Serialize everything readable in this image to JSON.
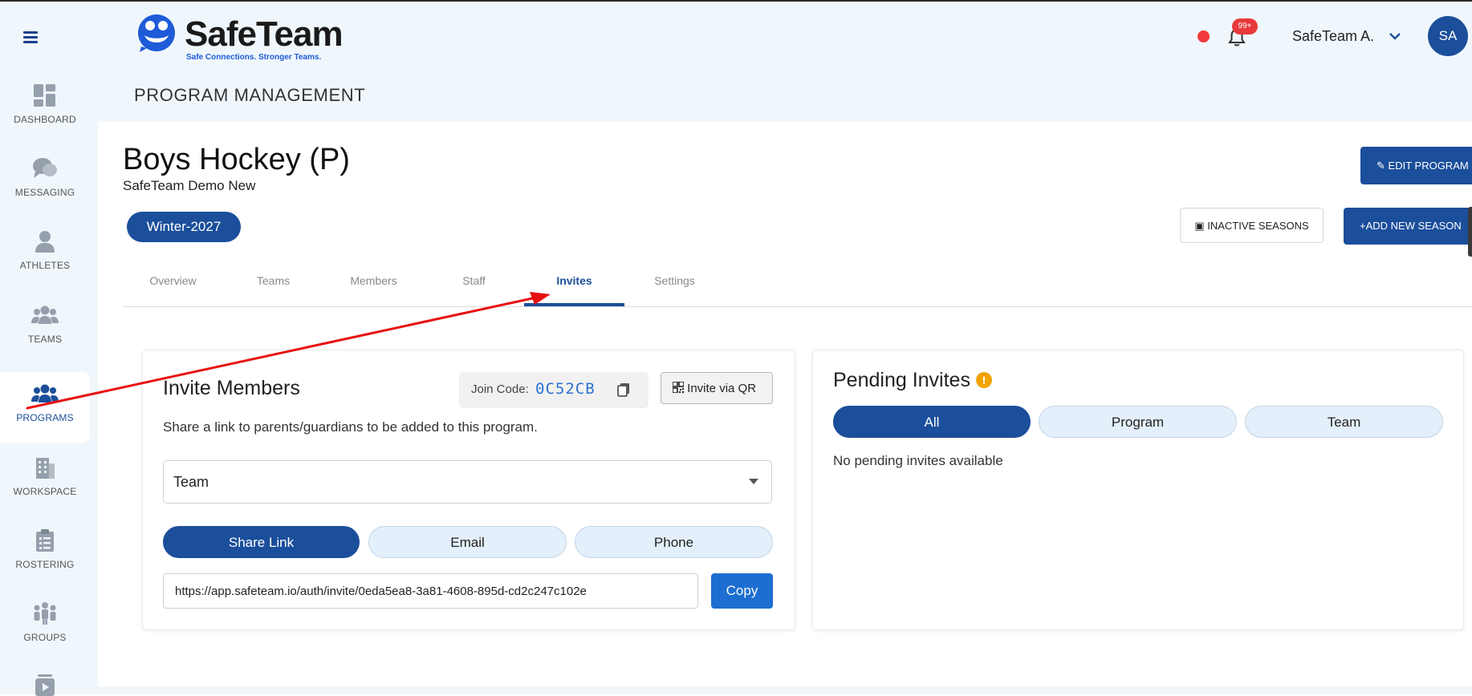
{
  "app": {
    "name": "SafeTeam",
    "tagline": "Safe Connections. Stronger Teams.",
    "accent_color": "#1b4e9b",
    "page_title": "PROGRAM MANAGEMENT"
  },
  "sidebar": {
    "items": [
      {
        "label": "DASHBOARD",
        "icon": "dashboard-icon",
        "active": false
      },
      {
        "label": "MESSAGING",
        "icon": "chat-bubbles-icon",
        "active": false
      },
      {
        "label": "ATHLETES",
        "icon": "person-icon",
        "active": false
      },
      {
        "label": "TEAMS",
        "icon": "group-icon",
        "active": false
      },
      {
        "label": "PROGRAMS",
        "icon": "programs-icon",
        "active": true
      },
      {
        "label": "WORKSPACE",
        "icon": "building-icon",
        "active": false
      },
      {
        "label": "ROSTERING",
        "icon": "clipboard-icon",
        "active": false
      },
      {
        "label": "GROUPS",
        "icon": "people-group-icon",
        "active": false
      },
      {
        "label": "",
        "icon": "video-icon",
        "active": false
      }
    ]
  },
  "header": {
    "notification_badge": "99+",
    "user_name": "SafeTeam A.",
    "avatar_initials": "SA",
    "status_dot_color": "#f0393a"
  },
  "program": {
    "name": "Boys Hockey (P)",
    "organization": "SafeTeam Demo New",
    "season": "Winter-2027",
    "edit_button": "EDIT PROGRAM",
    "inactive_seasons_button": "INACTIVE SEASONS",
    "add_season_button": "ADD NEW SEASON"
  },
  "tabs": [
    {
      "label": "Overview",
      "active": false
    },
    {
      "label": "Teams",
      "active": false
    },
    {
      "label": "Members",
      "active": false
    },
    {
      "label": "Staff",
      "active": false
    },
    {
      "label": "Invites",
      "active": true
    },
    {
      "label": "Settings",
      "active": false
    }
  ],
  "invite_members": {
    "title": "Invite Members",
    "join_code_label": "Join Code:",
    "join_code": "0C52CB",
    "invite_qr_label": "Invite via QR",
    "description": "Share a link to parents/guardians to be added to this program.",
    "select_value": "Team",
    "methods": [
      {
        "label": "Share Link",
        "active": true
      },
      {
        "label": "Email",
        "active": false
      },
      {
        "label": "Phone",
        "active": false
      }
    ],
    "link": "https://app.safeteam.io/auth/invite/0eda5ea8-3a81-4608-895d-cd2c247c102e",
    "copy_label": "Copy"
  },
  "pending_invites": {
    "title": "Pending Invites",
    "warning_symbol": "!",
    "filters": [
      {
        "label": "All",
        "active": true
      },
      {
        "label": "Program",
        "active": false
      },
      {
        "label": "Team",
        "active": false
      }
    ],
    "empty_message": "No pending invites available"
  },
  "annotation": {
    "arrow_color": "#e81010"
  }
}
